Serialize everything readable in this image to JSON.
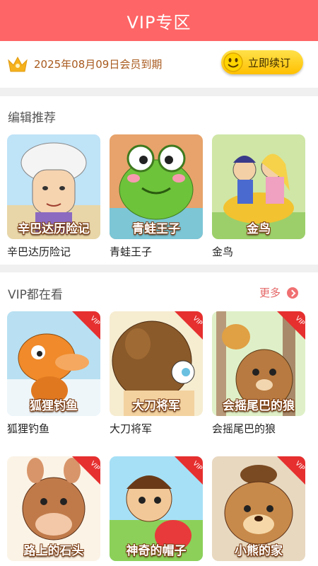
{
  "header": {
    "title": "VIP专区"
  },
  "membership": {
    "expiry_text": "2025年08月09日会员到期",
    "renew_label": "立即续订",
    "crown_icon": "crown-icon",
    "smile_icon": "smiley-icon"
  },
  "editor_picks": {
    "title": "编辑推荐",
    "items": [
      {
        "cover_caption": "辛巴达历险记",
        "title": "辛巴达历险记",
        "vip": false
      },
      {
        "cover_caption": "青蛙王子",
        "title": "青蛙王子",
        "vip": false
      },
      {
        "cover_caption": "金鸟",
        "title": "金鸟",
        "vip": false
      }
    ]
  },
  "vip_watching": {
    "title": "VIP都在看",
    "more_label": "更多",
    "badge_label": "VIP",
    "items": [
      {
        "cover_caption": "狐狸钓鱼",
        "title": "狐狸钓鱼",
        "vip": true
      },
      {
        "cover_caption": "大刀将军",
        "title": "大刀将军",
        "vip": true
      },
      {
        "cover_caption": "会摇尾巴的狼",
        "title": "会摇尾巴的狼",
        "vip": true
      },
      {
        "cover_caption": "路上的石头",
        "title": "",
        "vip": true
      },
      {
        "cover_caption": "神奇的帽子",
        "title": "",
        "vip": true
      },
      {
        "cover_caption": "小熊的家",
        "title": "",
        "vip": true
      }
    ]
  },
  "colors": {
    "header": "#fe6566",
    "accent": "#e62f2f",
    "renew_button": "#ffc000",
    "expiry_text": "#a85a1e"
  }
}
